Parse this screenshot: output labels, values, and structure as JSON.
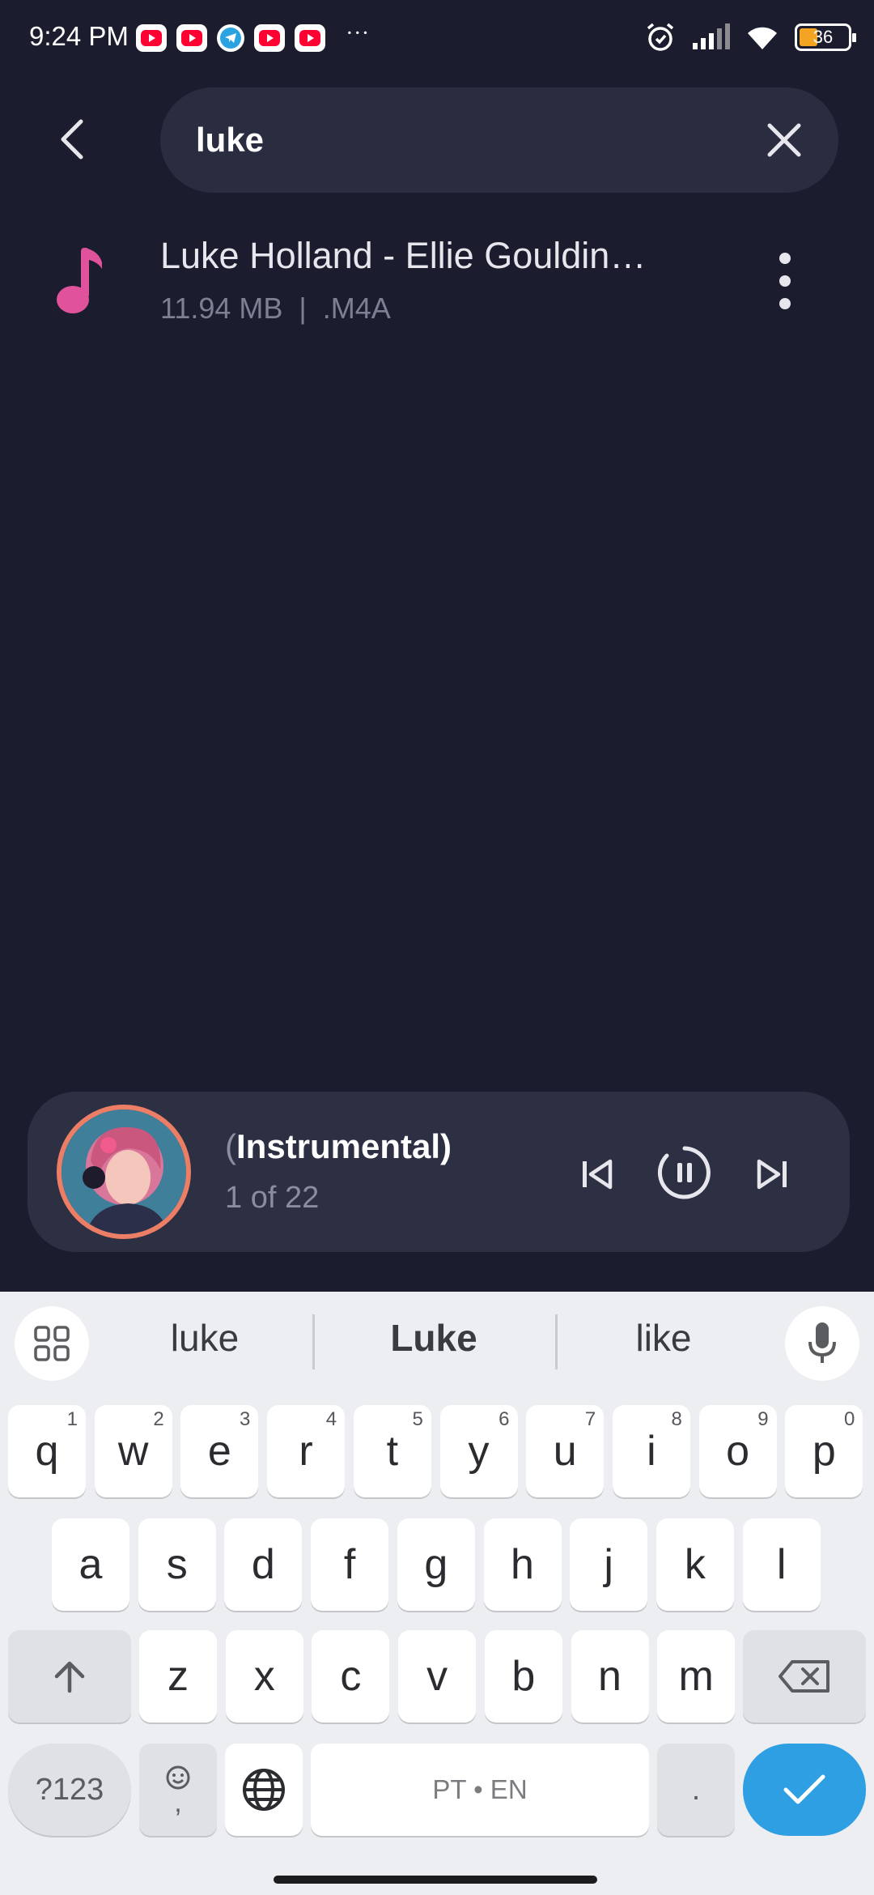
{
  "status_bar": {
    "time": "9:24 PM",
    "more": "···",
    "battery_level": "36",
    "notification_icons": [
      "youtube-icon",
      "youtube-icon",
      "telegram-icon",
      "youtube-icon",
      "youtube-icon"
    ],
    "system_icons": [
      "alarm-icon",
      "signal-icon",
      "wifi-icon",
      "battery-icon"
    ]
  },
  "search": {
    "value": "luke",
    "back_icon": "back-arrow-icon",
    "clear_icon": "close-icon"
  },
  "results": [
    {
      "title": "Luke Holland - Ellie Gouldin…",
      "meta": "11.94 MB  |  .M4A",
      "icon": "music-note-icon"
    }
  ],
  "now_playing": {
    "title_paren": "(",
    "title": "Instrumental)",
    "position": "1 of 22"
  },
  "keyboard": {
    "suggestions": [
      "luke",
      "Luke",
      "like"
    ],
    "row1": [
      {
        "k": "q",
        "h": "1"
      },
      {
        "k": "w",
        "h": "2"
      },
      {
        "k": "e",
        "h": "3"
      },
      {
        "k": "r",
        "h": "4"
      },
      {
        "k": "t",
        "h": "5"
      },
      {
        "k": "y",
        "h": "6"
      },
      {
        "k": "u",
        "h": "7"
      },
      {
        "k": "i",
        "h": "8"
      },
      {
        "k": "o",
        "h": "9"
      },
      {
        "k": "p",
        "h": "0"
      }
    ],
    "row2": [
      "a",
      "s",
      "d",
      "f",
      "g",
      "h",
      "j",
      "k",
      "l"
    ],
    "row3": [
      "z",
      "x",
      "c",
      "v",
      "b",
      "n",
      "m"
    ],
    "symbols_label": "?123",
    "comma_label": ",",
    "space_label": "PT • EN",
    "period_label": "."
  },
  "colors": {
    "background": "#1b1d2e",
    "accent_pink": "#e0529c",
    "enter_blue": "#2f9fe4"
  }
}
